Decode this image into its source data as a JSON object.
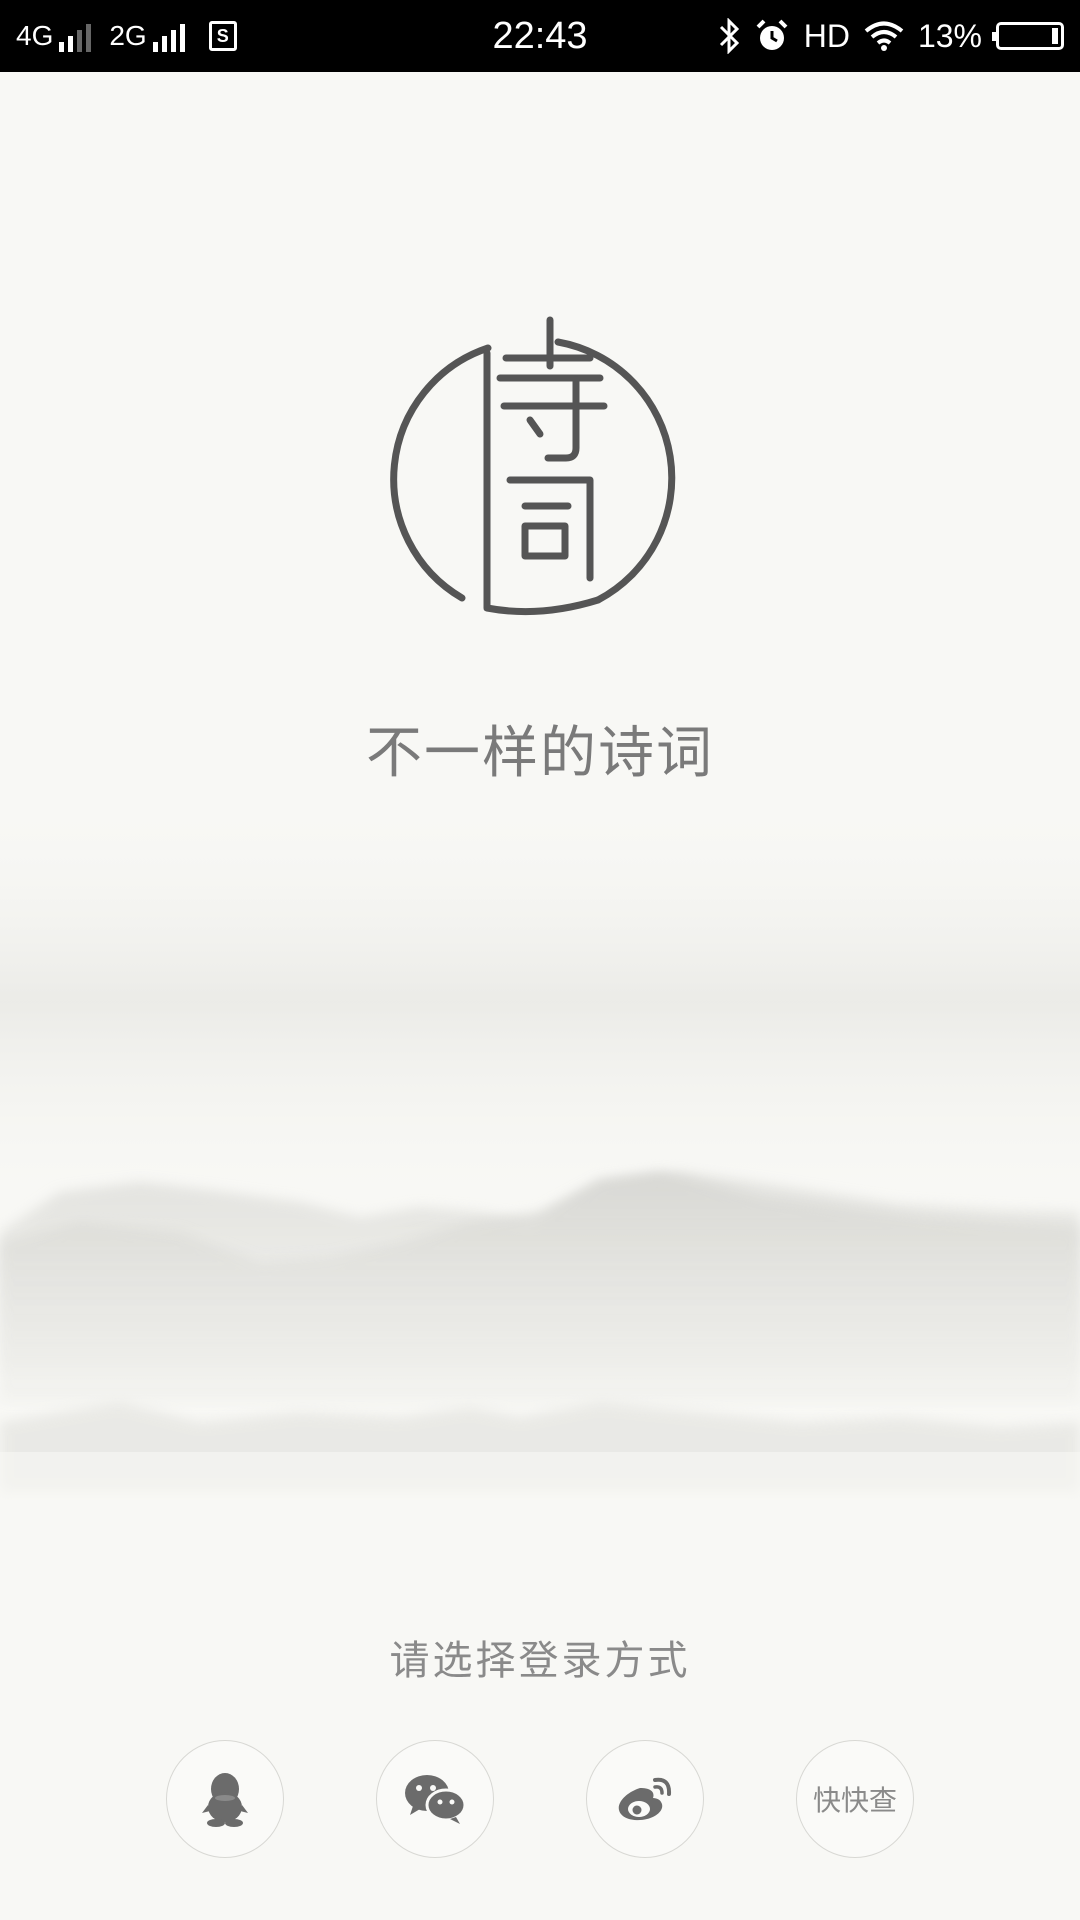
{
  "status_bar": {
    "network1": "4G",
    "network2": "2G",
    "sim_icon": "sim-s-icon",
    "time": "22:43",
    "hd": "HD",
    "battery": "13%"
  },
  "app": {
    "logo_icon": "shici-logo-icon",
    "slogan": "不一样的诗词",
    "login_prompt": "请选择登录方式"
  },
  "login_options": [
    {
      "id": "qq",
      "icon": "qq-penguin-icon"
    },
    {
      "id": "wechat",
      "icon": "wechat-icon"
    },
    {
      "id": "weibo",
      "icon": "weibo-icon"
    },
    {
      "id": "kuaikuaicha",
      "label": "快快查"
    }
  ],
  "colors": {
    "background": "#f8f8f5",
    "logo_stroke": "#555555",
    "text": "#7a7a7a"
  }
}
